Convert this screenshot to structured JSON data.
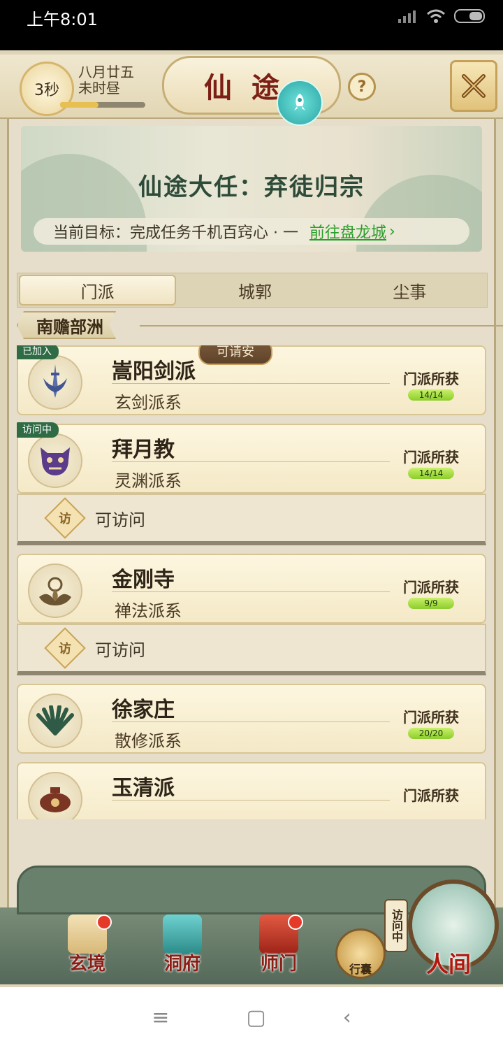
{
  "status": {
    "time": "上午8:01"
  },
  "header": {
    "timer": "3秒",
    "date_line1": "八月廿五",
    "date_line2": "未时昼",
    "title": "仙途",
    "help_label": "?"
  },
  "banner": {
    "title": "仙途大任：弃徒归宗",
    "goal_label": "当前目标：完成任务千机百窍心 · 一",
    "goal_link": "前往盘龙城"
  },
  "tabs": [
    {
      "label": "门派"
    },
    {
      "label": "城郭"
    },
    {
      "label": "尘事"
    }
  ],
  "region": "南赡部洲",
  "sects": [
    {
      "name": "嵩阳剑派",
      "type": "玄剑派系",
      "gain_label": "门派所获",
      "gain": "14/14",
      "badge": "已加入",
      "bubble": "可请安"
    },
    {
      "name": "拜月教",
      "type": "灵渊派系",
      "gain_label": "门派所获",
      "gain": "14/14",
      "badge": "访问中",
      "visit": "可访问"
    },
    {
      "name": "金刚寺",
      "type": "禅法派系",
      "gain_label": "门派所获",
      "gain": "9/9",
      "visit": "可访问"
    },
    {
      "name": "徐家庄",
      "type": "散修派系",
      "gain_label": "门派所获",
      "gain": "20/20"
    },
    {
      "name": "玉清派",
      "type": "",
      "gain_label": "门派所获",
      "gain": ""
    }
  ],
  "visit_icon": "访",
  "bottom_nav": [
    {
      "label": "玄境",
      "dot": true
    },
    {
      "label": "洞府",
      "dot": false
    },
    {
      "label": "师门",
      "dot": true
    }
  ],
  "pouch_label": "行囊",
  "visiting_label": "访问中",
  "world_label": "人间",
  "colors": {
    "accent": "#7c1f14",
    "link": "#2a9d2a",
    "badge": "#2f6b45"
  }
}
